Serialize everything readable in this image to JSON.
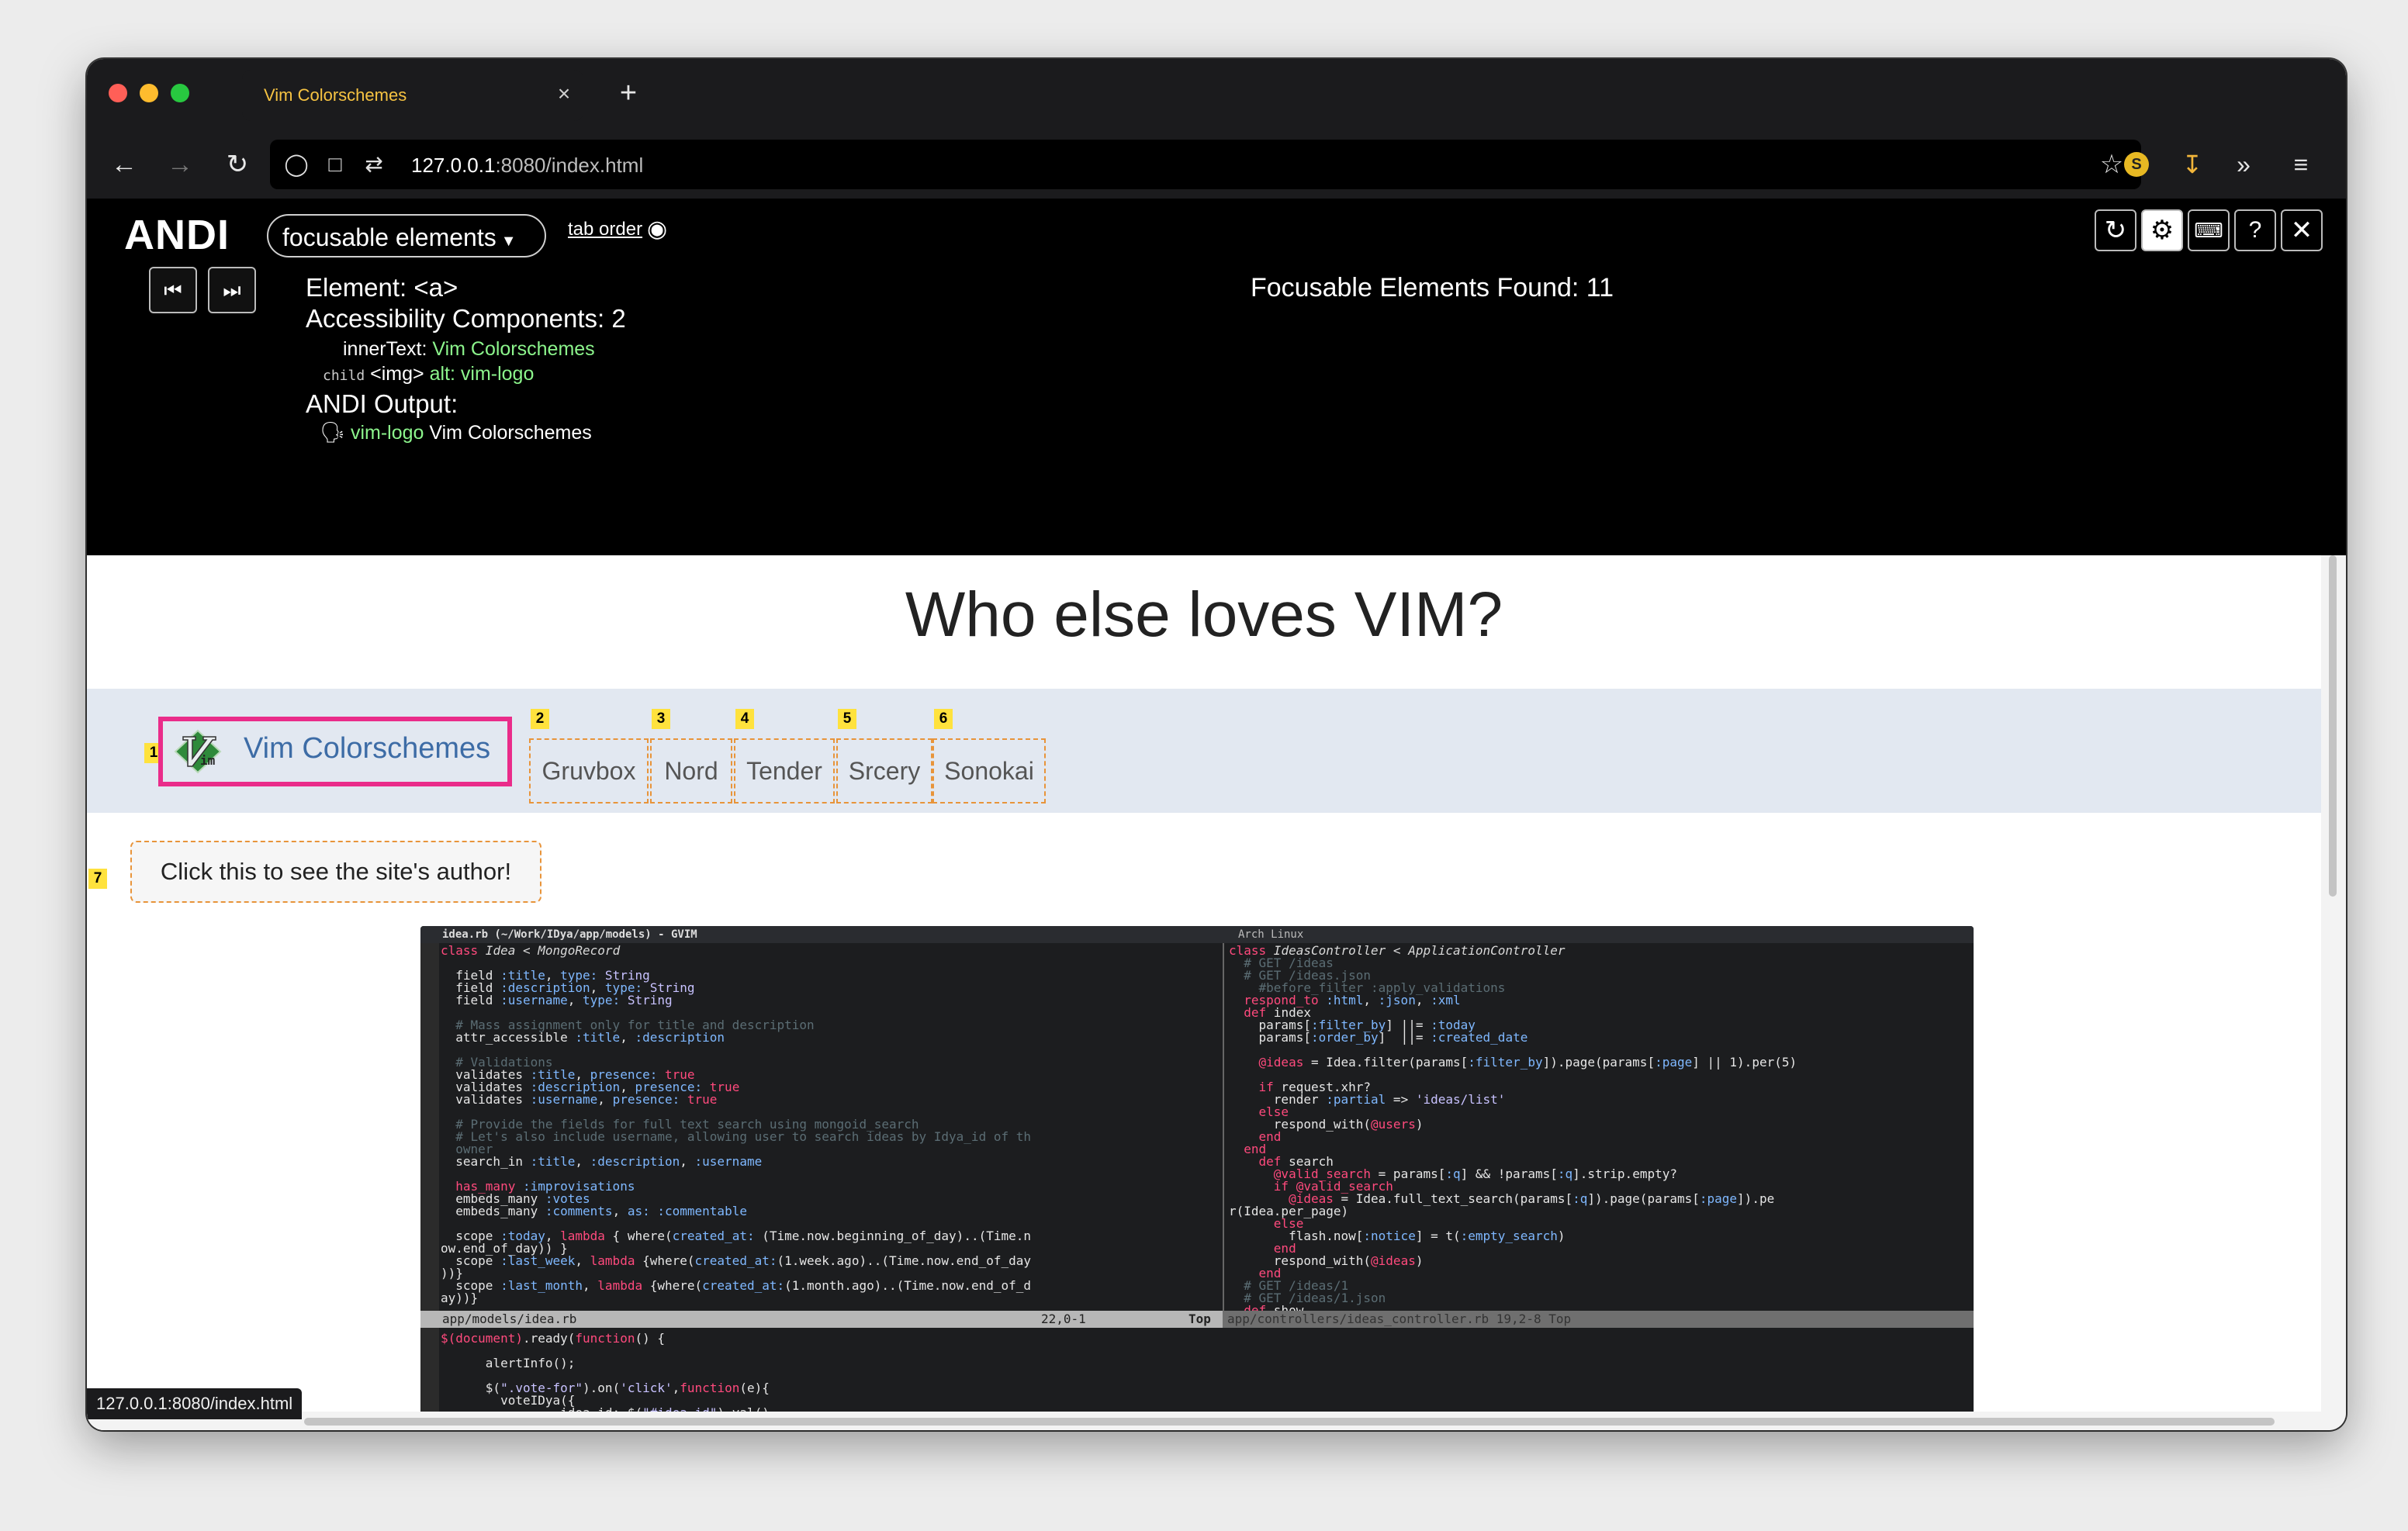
{
  "browser": {
    "tab_title": "Vim Colorschemes",
    "tab_close": "×",
    "new_tab": "+",
    "url_host": "127.0.0.1",
    "url_path": ":8080/index.html",
    "profile_initial": "S",
    "status_url": "127.0.0.1:8080/index.html"
  },
  "andi": {
    "logo": "ANDI",
    "mode": "focusable elements",
    "tab_order": "tab order",
    "element": "Element: <a>",
    "components": "Accessibility Components: 2",
    "inner_text_label": "innerText:",
    "inner_text_value": "Vim Colorschemes",
    "child_label": "child",
    "child_tag": "<img>",
    "child_alt_label": "alt:",
    "child_alt_value": "vim-logo",
    "output_label": "ANDI Output:",
    "output_green": "vim-logo",
    "output_text": "Vim Colorschemes",
    "found": "Focusable Elements Found: 11"
  },
  "page": {
    "heading": "Who else loves VIM?",
    "vim_link": "Vim Colorschemes",
    "themes": [
      {
        "num": "2",
        "label": "Gruvbox"
      },
      {
        "num": "3",
        "label": "Nord"
      },
      {
        "num": "4",
        "label": "Tender"
      },
      {
        "num": "5",
        "label": "Srcery"
      },
      {
        "num": "6",
        "label": "Sonokai"
      }
    ],
    "marker_1": "1",
    "marker_7": "7",
    "author_button": "Click this to see the site's author!"
  },
  "vim_screenshot": {
    "title_left": "idea.rb (~/Work/IDya/app/models) - GVIM",
    "title_right": "Arch Linux",
    "status_left": "app/models/idea.rb",
    "status_pos": "22,0-1",
    "status_top": "Top",
    "status_right": "app/controllers/ideas_controller.rb                         19,2-8                    Top"
  },
  "colors": {
    "andi_bg": "#000000",
    "focus_outline": "#ea2c8a",
    "marker_yellow": "#ffe23d",
    "dashed_orange": "#e8943a",
    "link_blue": "#3d6ca6",
    "tab_title": "#f6c342",
    "andi_green": "#8cf58c"
  }
}
